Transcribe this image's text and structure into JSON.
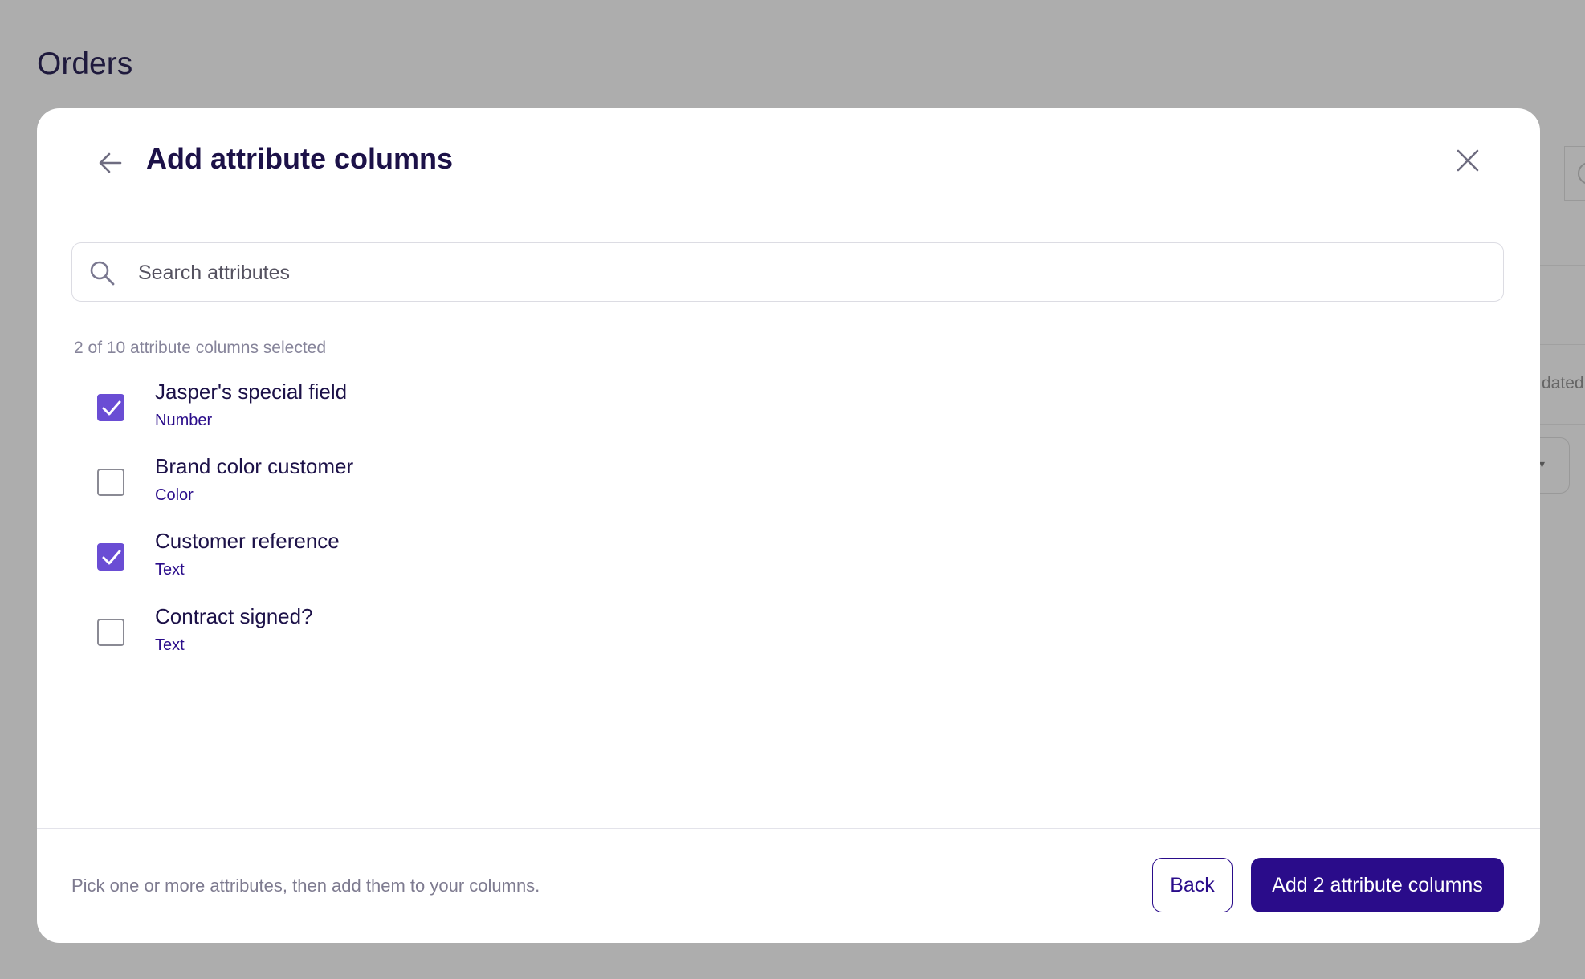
{
  "page": {
    "title": "Orders"
  },
  "background": {
    "partial_label": "dated"
  },
  "modal": {
    "title": "Add attribute columns",
    "search": {
      "placeholder": "Search attributes",
      "value": ""
    },
    "selected_count": "2 of 10 attribute columns selected",
    "attributes": [
      {
        "name": "Jasper's special field",
        "type": "Number",
        "checked": true
      },
      {
        "name": "Brand color customer",
        "type": "Color",
        "checked": false
      },
      {
        "name": "Customer reference",
        "type": "Text",
        "checked": true
      },
      {
        "name": "Contract signed?",
        "type": "Text",
        "checked": false
      }
    ],
    "footer": {
      "hint": "Pick one or more attributes, then add them to your columns.",
      "back_label": "Back",
      "primary_label": "Add 2 attribute columns"
    }
  },
  "icons": {
    "back": "arrow-left-icon",
    "close": "close-icon",
    "search": "search-icon",
    "check": "checkmark-icon"
  },
  "colors": {
    "accent": "#2a0c8a",
    "checkbox_checked": "#6a4dd4",
    "overlay": "#adadad"
  }
}
